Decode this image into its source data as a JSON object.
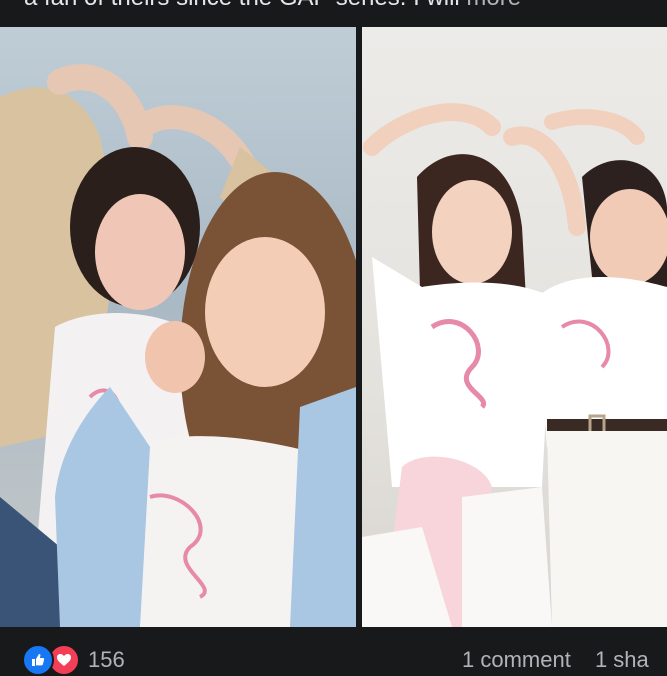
{
  "post": {
    "text": "a fan of theirs since the GAP series. I will",
    "see_more": "more"
  },
  "photos": [
    {
      "name": "left-photo"
    },
    {
      "name": "right-photo"
    }
  ],
  "reactions": {
    "count": "156",
    "icons": [
      "like-icon",
      "love-icon"
    ],
    "like_color": "#1877f2",
    "love_color": "#f33e58"
  },
  "engagement": {
    "comments": "1 comment",
    "shares": "1 sha"
  }
}
